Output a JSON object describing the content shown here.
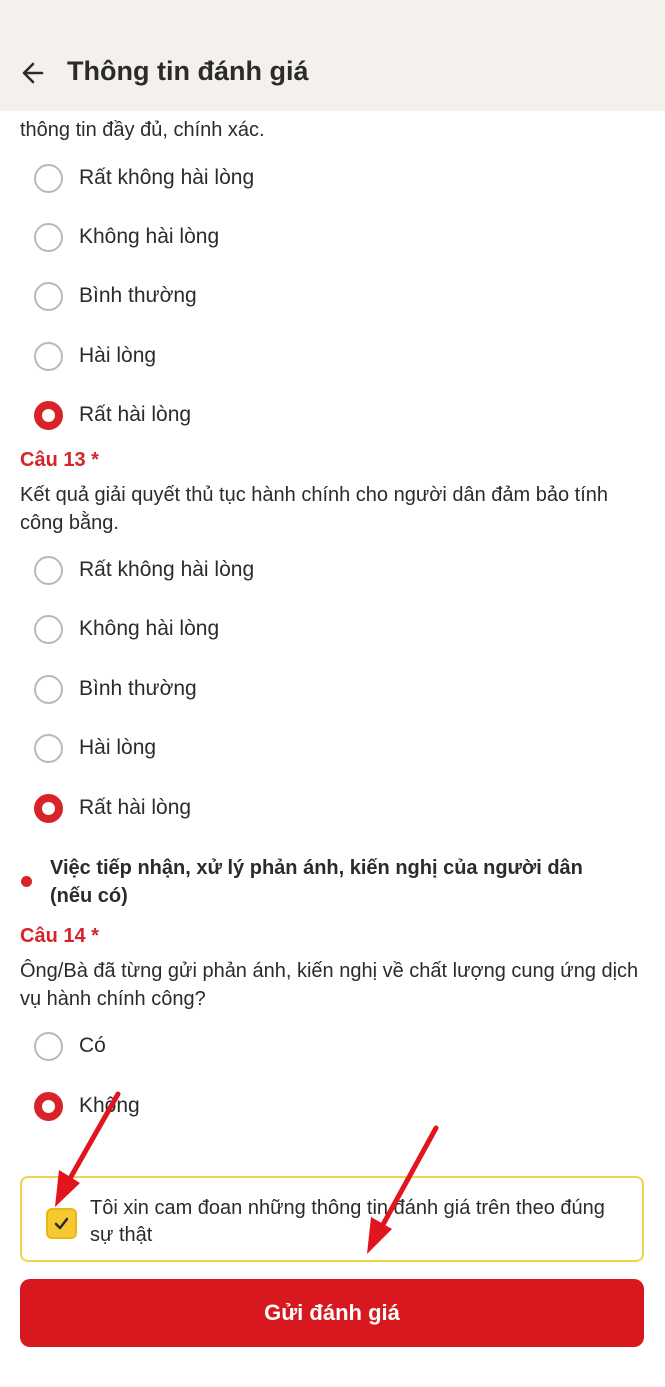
{
  "header": {
    "title": "Thông tin đánh giá",
    "back_icon": "arrow-left-icon"
  },
  "q12": {
    "text_tail": "thông tin đầy đủ, chính xác.",
    "options": [
      "Rất không hài lòng",
      "Không hài lòng",
      "Bình thường",
      "Hài lòng",
      "Rất hài lòng"
    ],
    "selected": "Rất hài lòng"
  },
  "q13": {
    "label": "Câu 13 *",
    "text": "Kết quả giải quyết thủ tục hành chính cho người dân đảm bảo tính công bằng.",
    "options": [
      "Rất không hài lòng",
      "Không hài lòng",
      "Bình thường",
      "Hài lòng",
      "Rất hài lòng"
    ],
    "selected": "Rất hài lòng"
  },
  "section": {
    "title": "Việc tiếp nhận, xử lý phản ánh, kiến nghị của người dân (nếu có)"
  },
  "q14": {
    "label": "Câu 14 *",
    "text": "Ông/Bà đã từng gửi phản ánh, kiến nghị về chất lượng cung ứng dịch vụ hành chính công?",
    "options": [
      "Có",
      "Không"
    ],
    "selected": "Không"
  },
  "commitment": {
    "text": "Tôi xin cam đoan những thông tin đánh giá trên theo đúng sự thật",
    "checked": true
  },
  "submit": {
    "label": "Gửi đánh giá"
  },
  "colors": {
    "accent": "#d7242a",
    "header_bg": "#f4f1ec",
    "checkbox": "#f7c930"
  }
}
